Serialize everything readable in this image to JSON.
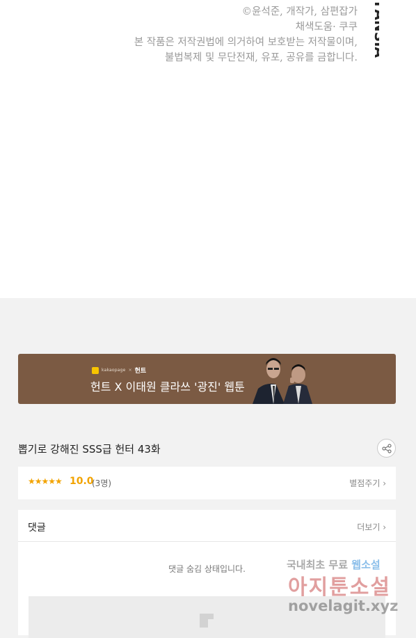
{
  "copyright": {
    "lines": [
      "©윤석준, 개작가, 삼편잡가",
      "채색도움· 쿠쿠",
      "본 작품은 저작권법에 의거하여 보호받는 저작물이며,",
      "불법복제 및 무단전재, 유포, 공유를 금합니다."
    ],
    "brand": "FANSIA"
  },
  "banner": {
    "logo_text": "kakaopage",
    "logo_sep": "×",
    "logo_partner": "헌트",
    "title": "헌트 X 이태원 클라쓰 '광진' 웹툰"
  },
  "episode": {
    "title": "뽑기로 강해진 SSS급 헌터 43화"
  },
  "rating": {
    "stars": "★★★★★",
    "score": "10.0",
    "count": "(3명)",
    "rate_link": "별점주기 ›"
  },
  "comments": {
    "heading": "댓글",
    "more": "더보기 ›",
    "hidden_message": "댓글 숨김 상태입니다."
  },
  "watermark": {
    "line1_a": "국내최초 무료",
    "line1_b": "웹소설",
    "line2": "아지툰소설",
    "line3": "novelagit.xyz"
  }
}
